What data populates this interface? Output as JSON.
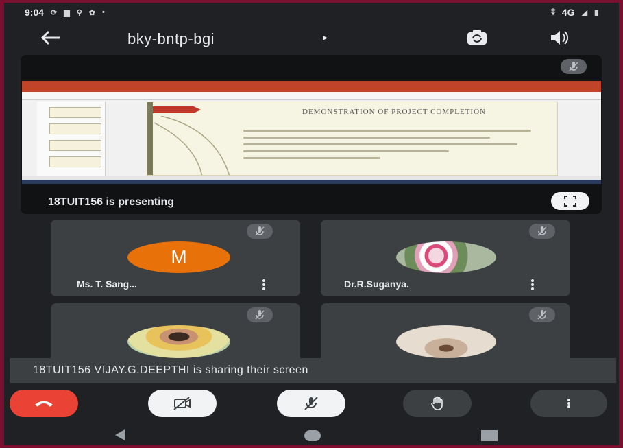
{
  "status_bar": {
    "time": "9:04",
    "network": "4G"
  },
  "meeting": {
    "code": "bky-bntp-bgi",
    "caret": "▸"
  },
  "presentation": {
    "presenter_text": "18TUIT156 is presenting",
    "slide_title": "DEMONSTRATION OF PROJECT COMPLETION"
  },
  "participants": [
    {
      "name": "Ms. T. Sang...",
      "avatar_letter": "M",
      "avatar_color": "#e8710a"
    },
    {
      "name": "Dr.R.Suganya."
    },
    {
      "name": ""
    },
    {
      "name": ""
    }
  ],
  "toast": {
    "text": "18TUIT156 VIJAY.G.DEEPTHI is sharing their screen"
  },
  "colors": {
    "end_call": "#ea4335",
    "background": "#202124",
    "tile": "#3c4043",
    "frame": "#7a1030"
  },
  "icons": [
    "back-arrow-icon",
    "switch-camera-icon",
    "speaker-icon",
    "mic-off-icon",
    "fullscreen-icon",
    "more-vert-icon",
    "end-call-icon",
    "camera-off-icon",
    "raise-hand-icon"
  ]
}
